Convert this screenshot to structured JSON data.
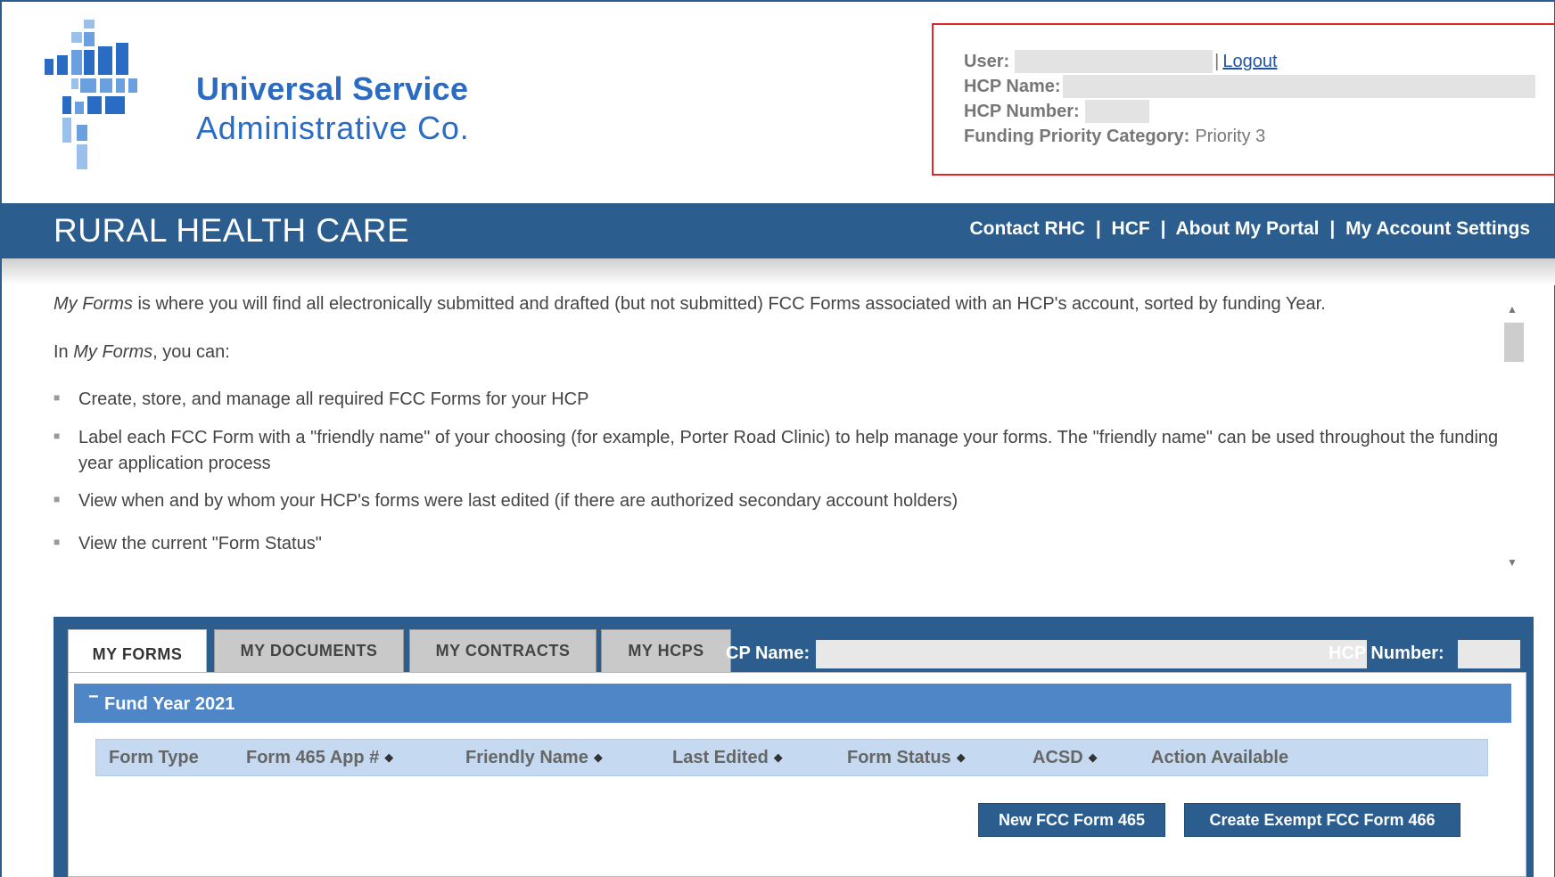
{
  "header": {
    "logo_line1": "Universal Service",
    "logo_line2": "Administrative Co."
  },
  "user_info": {
    "user_label": "User:",
    "user_value": "",
    "separator": "|",
    "logout_label": "Logout",
    "hcp_name_label": "HCP Name:",
    "hcp_name_value": "",
    "hcp_number_label": "HCP Number:",
    "hcp_number_value": "",
    "priority_label": "Funding Priority Category:",
    "priority_value": "Priority 3"
  },
  "navbar": {
    "title": "RURAL HEALTH CARE",
    "links": [
      "Contact RHC",
      "HCF",
      "About My Portal",
      "My Account Settings"
    ],
    "separator": "|"
  },
  "intro": {
    "para1_em": "My Forms",
    "para1_rest": " is where you will find all electronically submitted and drafted (but not submitted) FCC Forms associated with an HCP's account, sorted by funding Year.",
    "para2_prefix": "In ",
    "para2_em": "My Forms",
    "para2_suffix": ", you can:",
    "bullet_glyph": "■",
    "bullets": [
      "Create, store, and manage all required FCC Forms for your HCP",
      "Label each FCC Form with a \"friendly name\" of your choosing (for example, Porter Road Clinic) to help manage your forms. The \"friendly name\" can be used throughout the funding year application process",
      "View when and by whom your HCP's forms were last edited (if there are authorized secondary account holders)",
      "View the current \"Form Status\""
    ]
  },
  "tabs": [
    {
      "label": "MY FORMS",
      "active": true
    },
    {
      "label": "MY DOCUMENTS",
      "active": false
    },
    {
      "label": "MY CONTRACTS",
      "active": false
    },
    {
      "label": "MY HCPS",
      "active": false
    }
  ],
  "panel": {
    "hcp_name_label": "CP Name:",
    "hcp_number_label": "HCP Number:",
    "fund_year_toggle": "−",
    "fund_year_title": "Fund Year 2021",
    "sort_glyph": "◆",
    "columns": [
      {
        "label": "Form Type",
        "sortable": false
      },
      {
        "label": "Form 465 App #",
        "sortable": true
      },
      {
        "label": "Friendly Name",
        "sortable": true
      },
      {
        "label": "Last Edited",
        "sortable": true
      },
      {
        "label": "Form Status",
        "sortable": true
      },
      {
        "label": "ACSD",
        "sortable": true
      },
      {
        "label": "Action Available",
        "sortable": false
      }
    ],
    "buttons": {
      "new_465": "New FCC Form 465",
      "exempt_466": "Create Exempt FCC Form 466"
    }
  },
  "colors": {
    "brand_blue": "#2b5e8f",
    "logo_blue": "#2a6bc4",
    "fund_year_blue": "#4f86c8",
    "table_header": "#c5d9f1",
    "alert_red": "#e0262c"
  }
}
